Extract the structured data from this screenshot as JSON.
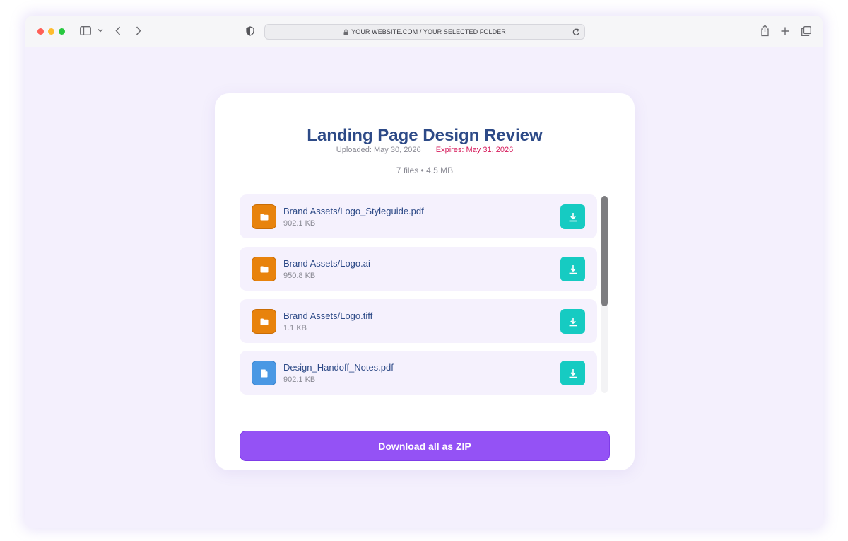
{
  "browser": {
    "url": "YOUR WEBSITE.COM / YOUR SELECTED FOLDER"
  },
  "page": {
    "title": "Landing Page Design Review",
    "uploaded": "Uploaded: May 30, 2026",
    "expires": "Expires: May 31, 2026",
    "summary": "7 files • 4.5 MB",
    "download_all_label": "Download all as ZIP"
  },
  "files": [
    {
      "name": "Brand Assets/Logo_Styleguide.pdf",
      "size": "902.1 KB",
      "icon": "folder-icon"
    },
    {
      "name": "Brand Assets/Logo.ai",
      "size": "950.8 KB",
      "icon": "folder-icon"
    },
    {
      "name": "Brand Assets/Logo.tiff",
      "size": "1.1 KB",
      "icon": "folder-icon"
    },
    {
      "name": "Design_Handoff_Notes.pdf",
      "size": "902.1 KB",
      "icon": "document-icon"
    }
  ],
  "colors": {
    "background": "#f4f0fd",
    "title": "#2d4a87",
    "expires": "#d6195a",
    "folder": "#e8830c",
    "document": "#4a98e4",
    "download_button": "#16cbc2",
    "zip_button": "#9452f5"
  }
}
